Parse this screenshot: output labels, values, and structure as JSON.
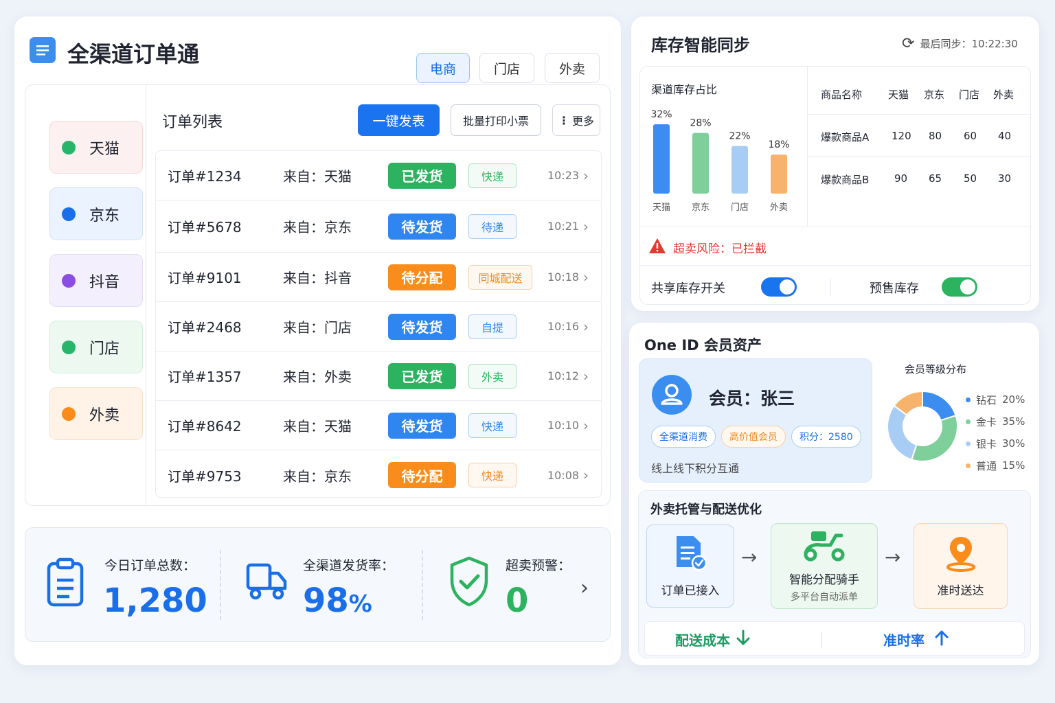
{
  "app": {
    "title": "全渠道订单通"
  },
  "top_tabs": [
    {
      "label": "电商"
    },
    {
      "label": "门店"
    },
    {
      "label": "外卖"
    }
  ],
  "channels": [
    {
      "label": "天猫"
    },
    {
      "label": "京东"
    },
    {
      "label": "抖音"
    },
    {
      "label": "门店"
    },
    {
      "label": "外卖"
    }
  ],
  "orders": {
    "title": "订单列表",
    "ship_all": "一键发表",
    "batch_print": "批量打印小票",
    "more": "更多",
    "rows": [
      {
        "id": "订单#1234",
        "source": "来自：天猫",
        "status": "已发货",
        "mode": "快递",
        "time": "10:23"
      },
      {
        "id": "订单#5678",
        "source": "来自：京东",
        "status": "待发货",
        "mode": "待递",
        "time": "10:21"
      },
      {
        "id": "订单#9101",
        "source": "来自：抖音",
        "status": "待分配",
        "mode": "同城配送",
        "time": "10:18"
      },
      {
        "id": "订单#2468",
        "source": "来自：门店",
        "status": "待发货",
        "mode": "自提",
        "time": "10:16"
      },
      {
        "id": "订单#1357",
        "source": "来自：外卖",
        "status": "已发货",
        "mode": "外卖",
        "time": "10:12"
      },
      {
        "id": "订单#8642",
        "source": "来自：天猫",
        "status": "待发货",
        "mode": "快递",
        "time": "10:10"
      },
      {
        "id": "订单#9753",
        "source": "来自：京东",
        "status": "待分配",
        "mode": "快递",
        "time": "10:08"
      }
    ]
  },
  "stats": [
    {
      "label": "今日订单总数：",
      "value": "1,280",
      "unit": ""
    },
    {
      "label": "全渠道发货率：",
      "value": "98",
      "unit": "%"
    },
    {
      "label": "超卖预警：",
      "value": "0",
      "unit": ""
    }
  ],
  "inventory": {
    "title": "库存智能同步",
    "sync_time": "最后同步：10:22:30",
    "chart_title": "渠道库存占比",
    "risk": "超卖风险：已拦截",
    "shared_toggle": "共享库存开关",
    "presale_toggle": "预售库存",
    "table": {
      "headers": [
        "商品名称",
        "天猫",
        "京东",
        "门店",
        "外卖"
      ],
      "rows": [
        [
          "爆款商品A",
          "120",
          "80",
          "60",
          "40"
        ],
        [
          "爆款商品B",
          "90",
          "65",
          "50",
          "30"
        ]
      ]
    }
  },
  "chart_data": {
    "type": "bar",
    "title": "渠道库存占比",
    "categories": [
      "天猫",
      "京东",
      "门店",
      "外卖"
    ],
    "values": [
      32,
      28,
      22,
      18
    ],
    "value_labels": [
      "32%",
      "28%",
      "22%",
      "18%"
    ],
    "colors": [
      "#3b8ef0",
      "#7fcf9b",
      "#a8cdf5",
      "#f7b26b"
    ]
  },
  "member": {
    "title": "One ID 会员资产",
    "name": "会员：张三",
    "tags": [
      "全渠道消费",
      "高价值会员",
      "积分：2580"
    ],
    "desc": "线上线下积分互通",
    "dist_title": "会员等级分布",
    "dist": [
      {
        "label": "钻石",
        "pct": "20%",
        "value": 20,
        "color": "#3b8ef0"
      },
      {
        "label": "金卡",
        "pct": "35%",
        "value": 35,
        "color": "#7fcf9b"
      },
      {
        "label": "银卡",
        "pct": "30%",
        "value": 30,
        "color": "#a8cdf5"
      },
      {
        "label": "普通",
        "pct": "15%",
        "value": 15,
        "color": "#f7b26b"
      }
    ]
  },
  "delivery": {
    "title": "外卖托管与配送优化",
    "steps": [
      {
        "label": "订单已接入",
        "sub": ""
      },
      {
        "label": "智能分配骑手",
        "sub": "多平台自动派单"
      },
      {
        "label": "准时送达",
        "sub": ""
      }
    ],
    "cost_label": "配送成本",
    "ontime_label": "准时率"
  }
}
